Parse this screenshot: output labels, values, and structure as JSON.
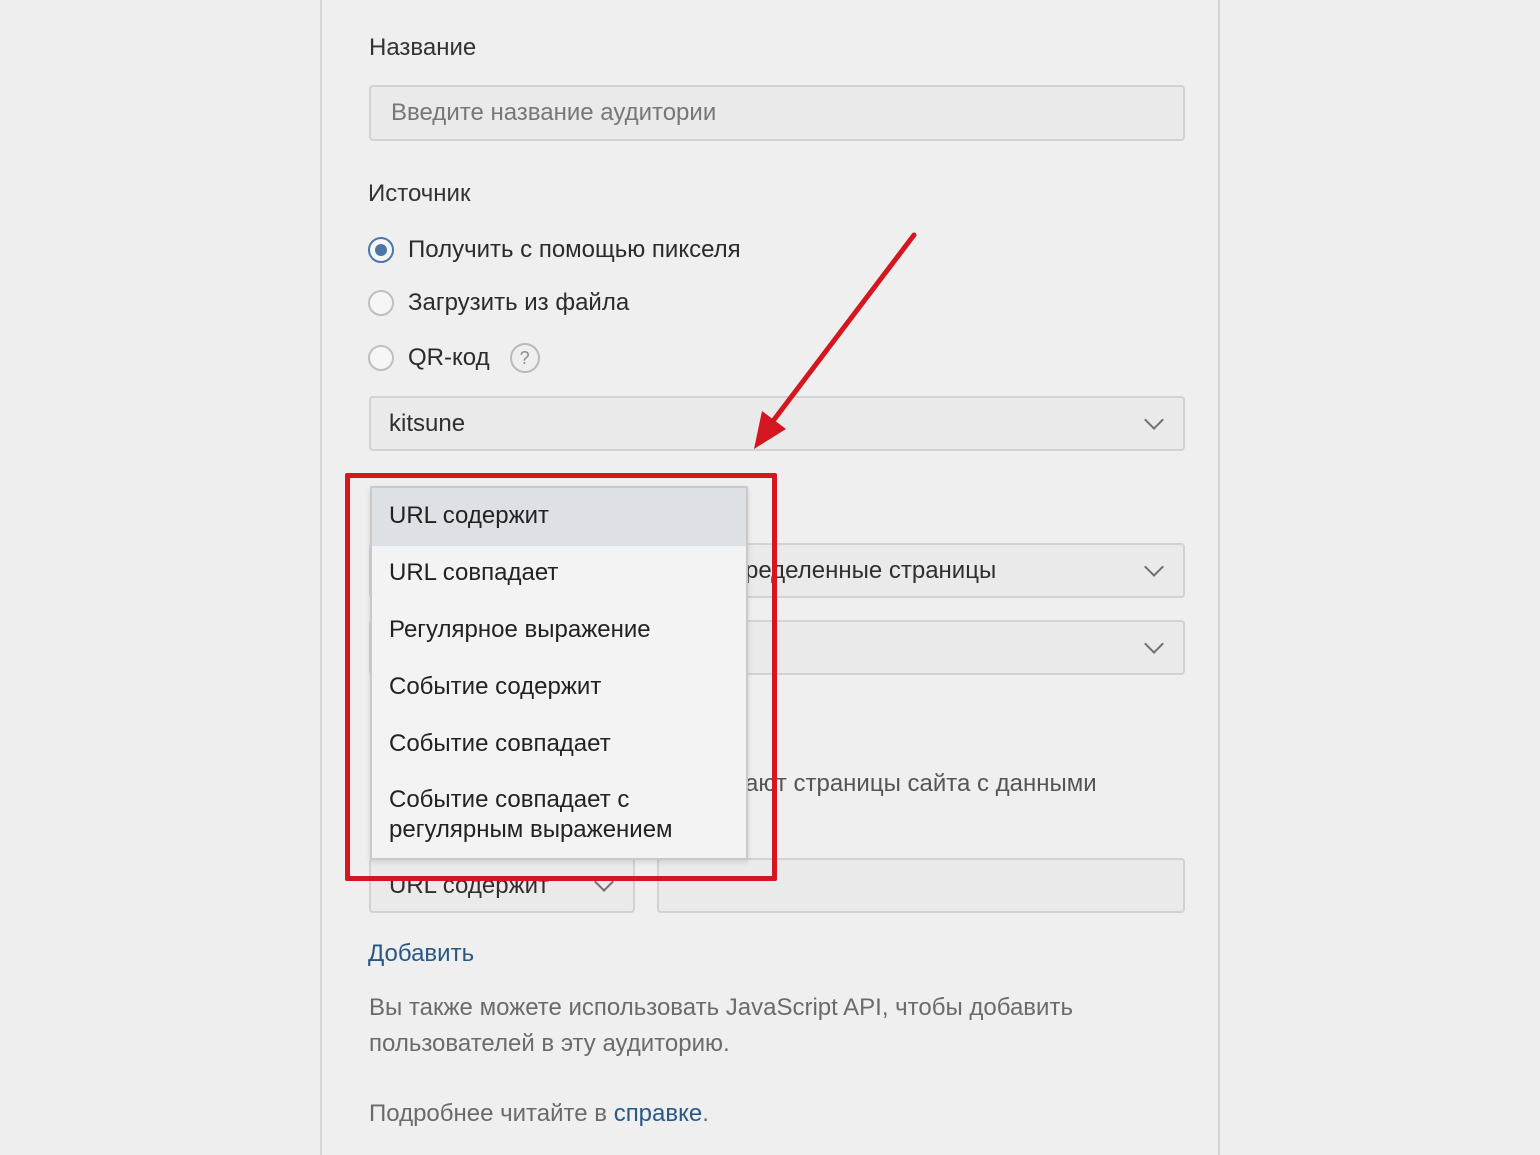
{
  "form": {
    "name_label": "Название",
    "name_placeholder": "Введите название аудитории",
    "source_label": "Источник",
    "radios": [
      {
        "label": "Получить с помощью пикселя",
        "checked": true
      },
      {
        "label": "Загрузить из файла",
        "checked": false
      },
      {
        "label": "QR-код",
        "checked": false
      }
    ],
    "help_icon_text": "?",
    "pixel_select_value": "kitsune",
    "pages_select_value_partial": "ределенные страницы",
    "rule_text_partial": "ают страницы сайта с данными",
    "rule_type_select_value": "URL содержит",
    "add_link": "Добавить",
    "js_api_note": "Вы также можете использовать JavaScript API, чтобы добавить пользователей в эту аудиторию.",
    "help_prefix": "Подробнее читайте в ",
    "help_link": "справке",
    "help_suffix": "."
  },
  "dropdown": {
    "options": [
      "URL содержит",
      "URL совпадает",
      "Регулярное выражение",
      "Событие содержит",
      "Событие совпадает",
      "Событие совпадает с регулярным выражением"
    ],
    "selected_index": 0
  },
  "annotation": {
    "arrow_color": "#d3161f",
    "box_color": "#d3161f"
  },
  "colors": {
    "accent": "#4a76a8",
    "link": "#2a5885",
    "background": "#eeeeee"
  }
}
